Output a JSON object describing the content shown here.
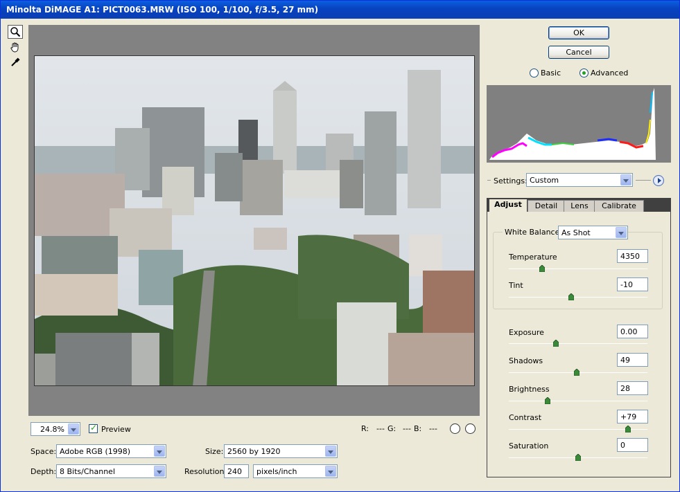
{
  "window": {
    "title": "Minolta DiMAGE A1:  PICT0063.MRW  (ISO 100, 1/100, f/3.5, 27 mm)"
  },
  "tools": [
    {
      "name": "zoom-tool",
      "icon": "magnifier-icon",
      "active": true
    },
    {
      "name": "hand-tool",
      "icon": "hand-icon",
      "active": false
    },
    {
      "name": "white-balance-tool",
      "icon": "eyedropper-icon",
      "active": false
    }
  ],
  "preview": {
    "zoom_value": "24.8%",
    "preview_label": "Preview",
    "preview_checked": true,
    "readout": {
      "r_label": "R:",
      "r_value": "---",
      "g_label": "G:",
      "g_value": "---",
      "b_label": "B:",
      "b_value": "---"
    }
  },
  "workflow": {
    "space_label": "Space:",
    "space_value": "Adobe RGB (1998)",
    "depth_label": "Depth:",
    "depth_value": "8 Bits/Channel",
    "size_label": "Size:",
    "size_value": "2560 by 1920",
    "resolution_label": "Resolution:",
    "resolution_value": "240",
    "resolution_unit": "pixels/inch"
  },
  "buttons": {
    "ok": "OK",
    "cancel": "Cancel"
  },
  "mode": {
    "basic": "Basic",
    "advanced": "Advanced",
    "selected": "Advanced"
  },
  "settings": {
    "label": "Settings:",
    "value": "Custom"
  },
  "tabs": [
    {
      "label": "Adjust",
      "active": true
    },
    {
      "label": "Detail",
      "active": false
    },
    {
      "label": "Lens",
      "active": false
    },
    {
      "label": "Calibrate",
      "active": false
    }
  ],
  "adjust": {
    "white_balance_label": "White Balance:",
    "white_balance_value": "As Shot",
    "sliders": [
      {
        "label": "Temperature",
        "value": "4350",
        "position": 0.24
      },
      {
        "label": "Tint",
        "value": "-10",
        "position": 0.45
      },
      {
        "label": "Exposure",
        "value": "0.00",
        "position": 0.34
      },
      {
        "label": "Shadows",
        "value": "49",
        "position": 0.49
      },
      {
        "label": "Brightness",
        "value": "28",
        "position": 0.28
      },
      {
        "label": "Contrast",
        "value": "+79",
        "position": 0.86
      },
      {
        "label": "Saturation",
        "value": "0",
        "position": 0.5
      }
    ]
  },
  "colors": {
    "title_bar": "#0A5FE0",
    "accent_green": "#21A121",
    "preview_bg": "#828282"
  }
}
